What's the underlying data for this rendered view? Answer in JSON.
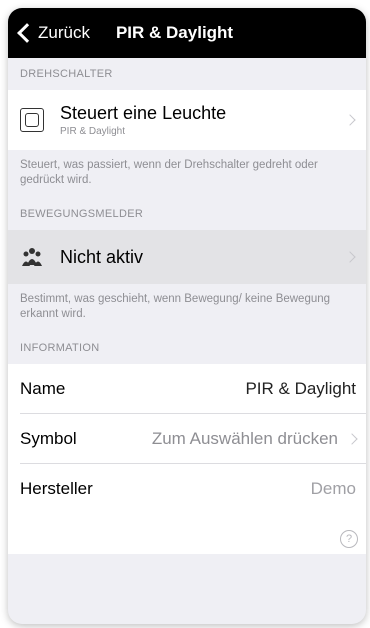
{
  "nav": {
    "back_label": "Zurück",
    "title": "PIR & Daylight"
  },
  "switch_section": {
    "header": "DREHSCHALTER",
    "cell_title": "Steuert eine Leuchte",
    "cell_subtitle": "PIR & Daylight",
    "footer": "Steuert, was passiert, wenn der Drehschalter gedreht oder gedrückt wird."
  },
  "motion_section": {
    "header": "BEWEGUNGSMELDER",
    "cell_title": "Nicht aktiv",
    "footer": "Bestimmt, was geschieht, wenn Bewegung/ keine Bewegung erkannt wird."
  },
  "info_section": {
    "header": "INFORMATION",
    "rows": [
      {
        "label": "Name",
        "value": "PIR & Daylight"
      },
      {
        "label": "Symbol",
        "value": "Zum Auswählen drücken"
      },
      {
        "label": "Hersteller",
        "value": "Demo"
      }
    ]
  },
  "help_glyph": "?"
}
